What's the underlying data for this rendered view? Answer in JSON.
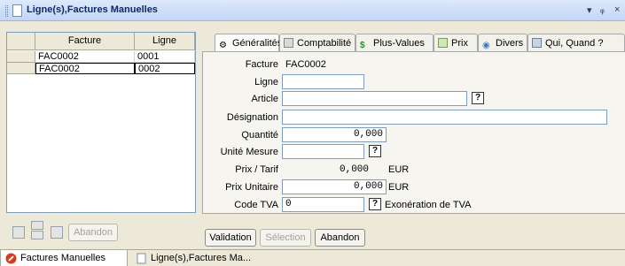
{
  "window": {
    "title": "Ligne(s),Factures Manuelles",
    "controls": {
      "dropdown": "▾",
      "pin": "ᵩ",
      "close": "×"
    }
  },
  "grid": {
    "columns": [
      "Facture",
      "Ligne"
    ],
    "rows": [
      {
        "facture": "FAC0002",
        "ligne": "0001"
      },
      {
        "facture": "FAC0002",
        "ligne": "0002"
      }
    ]
  },
  "left_toolbar": {
    "abandon_label": "Abandon"
  },
  "tabs": [
    {
      "label": "Généralités",
      "icon": "settings-icon"
    },
    {
      "label": "Comptabilité",
      "icon": "ledger-icon"
    },
    {
      "label": "Plus-Values",
      "icon": "dollar-icon"
    },
    {
      "label": "Prix",
      "icon": "price-icon"
    },
    {
      "label": "Divers",
      "icon": "misc-icon"
    },
    {
      "label": "Qui, Quand ?",
      "icon": "audit-icon"
    }
  ],
  "form": {
    "facture": {
      "label": "Facture",
      "value": "FAC0002"
    },
    "ligne": {
      "label": "Ligne",
      "value": ""
    },
    "article": {
      "label": "Article",
      "value": ""
    },
    "designation": {
      "label": "Désignation",
      "value": ""
    },
    "quantite": {
      "label": "Quantité",
      "value": "0,000"
    },
    "unite_mesure": {
      "label": "Unité Mesure",
      "value": ""
    },
    "prix_tarif": {
      "label": "Prix / Tarif",
      "value": "0,000",
      "currency": "EUR"
    },
    "prix_unitaire": {
      "label": "Prix Unitaire",
      "value": "0,000",
      "currency": "EUR"
    },
    "code_tva": {
      "label": "Code TVA",
      "value": "0",
      "description": "Exonération de TVA"
    },
    "help_label": "?"
  },
  "actions": {
    "validation_label": "Validation",
    "selection_label": "Sélection",
    "abandon_label": "Abandon"
  },
  "bottom_tabs": [
    {
      "label": "Factures Manuelles",
      "icon": "no-entry-icon",
      "active": true
    },
    {
      "label": "Ligne(s),Factures Ma...",
      "icon": "document-icon",
      "active": false
    }
  ],
  "colors": {
    "title_text": "#0b2a66",
    "titlebar_bg": "#c3d6f5",
    "panel_bg": "#f6f5ef",
    "no_entry_icon": "#d83b1e"
  }
}
